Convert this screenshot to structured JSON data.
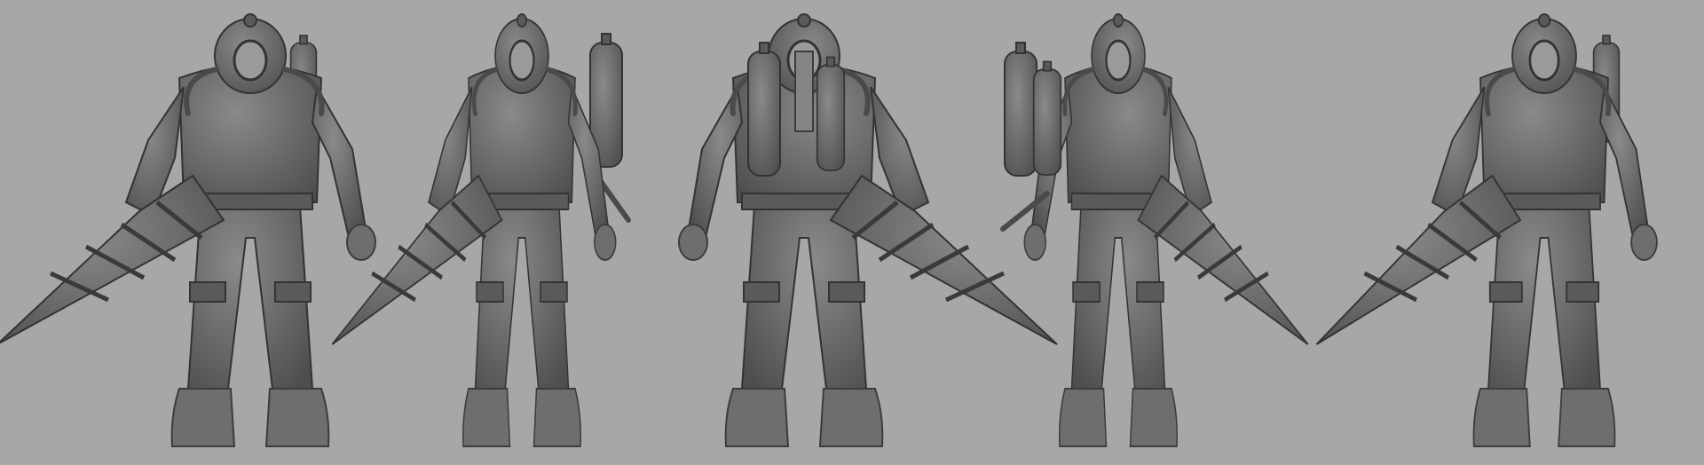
{
  "colors": {
    "background": "#a7a7a7",
    "clay": "#6e6e6e",
    "shadow": "#3c3c3c"
  }
}
